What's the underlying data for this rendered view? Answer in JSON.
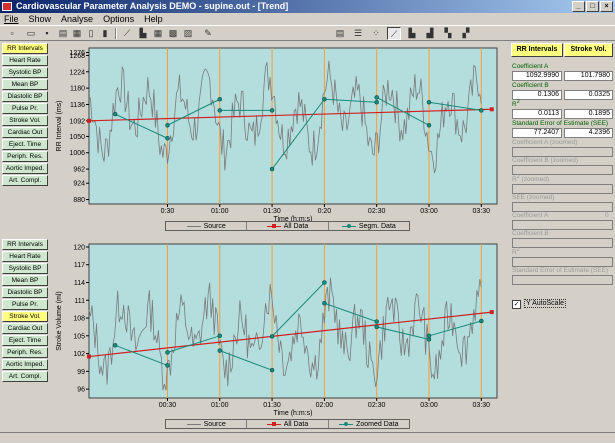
{
  "window": {
    "title": "Cardiovascular Parameter Analysis DEMO - supine.out - [Trend]",
    "min": "_",
    "max": "□",
    "close": "×"
  },
  "menu": [
    "File",
    "Show",
    "Analyse",
    "Options",
    "Help"
  ],
  "toolbar": {
    "icons": [
      "new-icon",
      "open-icon",
      "save-icon",
      "print-icon",
      "print-preview-icon",
      "copy-icon",
      "paste-icon",
      "export-icon",
      "report-icon",
      "line-tool-icon",
      "bar-tool-icon",
      "grid-tool-icon",
      "table-tool-icon",
      "marker-icon",
      "table-view-icon",
      "list-view-icon",
      "scatter-view-icon",
      "trend-view-icon",
      "histogram-view-icon",
      "spectrum-view-icon",
      "stats-view-icon",
      "colour-view-icon"
    ]
  },
  "params_top": [
    "RR Intervals",
    "Heart Rate",
    "Systolic BP",
    "Mean BP",
    "Diastolic BP",
    "Pulse Pr.",
    "Stroke Vol.",
    "Cardiac Out",
    "Eject. Time",
    "Periph. Res.",
    "Aortic Imped.",
    "Art. Compl."
  ],
  "params_top_selected": 0,
  "params_bottom": [
    "RR Intervals",
    "Heart Rate",
    "Systolic BP",
    "Mean BP",
    "Diastolic BP",
    "Pulse Pr.",
    "Stroke Vol.",
    "Cardiac Out",
    "Eject. Time",
    "Periph. Res.",
    "Aortic Imped.",
    "Art. Compl."
  ],
  "params_bottom_selected": 6,
  "chart_data": [
    {
      "type": "line",
      "ylabel": "RR Interval (ms)",
      "xlabel": "Time (h:m:s)",
      "ylim": [
        868,
        1288
      ],
      "y_ticks": [
        880,
        924,
        962,
        1006,
        1050,
        1092,
        1136,
        1180,
        1224,
        1268,
        1276
      ],
      "y_tick_labels": [
        "880",
        "924",
        "962",
        "1006",
        "1050",
        "1092",
        "1136",
        "1180",
        "1224",
        "1268",
        "1276"
      ],
      "x_ticks": [
        "0:30",
        "01:00",
        "01:30",
        "0:20",
        "02:30",
        "03:00",
        "03:30"
      ],
      "series": [
        {
          "name": "Source",
          "style": "oscillating gray trace"
        },
        {
          "name": "All Data",
          "start": 1092,
          "end": 1123
        },
        {
          "name": "Segm. Data",
          "points": [
            [
              0,
              1110
            ],
            [
              0.5,
              1045
            ],
            [
              0.5,
              1080
            ],
            [
              1,
              1150
            ],
            [
              1,
              1120
            ],
            [
              1.5,
              1120
            ],
            [
              1.5,
              962
            ],
            [
              2,
              1150
            ],
            [
              2.5,
              1142
            ],
            [
              2.5,
              1155
            ],
            [
              3,
              1080
            ],
            [
              3,
              1142
            ],
            [
              3.5,
              1120
            ]
          ]
        }
      ],
      "legend": [
        "Source",
        "All Data",
        "Segm. Data"
      ]
    },
    {
      "type": "line",
      "ylabel": "Stroke Volume (ml)",
      "xlabel": "Time (h:m:s)",
      "ylim": [
        94.5,
        120.5
      ],
      "y_ticks": [
        96,
        99,
        102,
        105,
        108,
        111,
        114,
        117,
        120
      ],
      "y_tick_labels": [
        "96",
        "99",
        "102",
        "105",
        "108",
        "111",
        "114",
        "117",
        "120"
      ],
      "x_ticks": [
        "00:30",
        "01:00",
        "01:30",
        "02:00",
        "02:30",
        "03:00",
        "03:30"
      ],
      "series": [
        {
          "name": "Source",
          "style": "oscillating gray trace"
        },
        {
          "name": "All Data",
          "start": 101.5,
          "end": 109.0
        },
        {
          "name": "Zoomed Data",
          "points": [
            [
              0,
              103.4
            ],
            [
              0.5,
              100.0
            ],
            [
              0.5,
              102.2
            ],
            [
              1,
              105.0
            ],
            [
              1,
              102.5
            ],
            [
              1.5,
              99.2
            ],
            [
              1.5,
              104.9
            ],
            [
              2,
              114.0
            ],
            [
              2,
              110.5
            ],
            [
              2.5,
              107.4
            ],
            [
              2.5,
              106.5
            ],
            [
              3,
              104.4
            ],
            [
              3,
              105.0
            ],
            [
              3.5,
              107.5
            ]
          ]
        }
      ],
      "legend": [
        "Source",
        "All Data",
        "Zoomed Data"
      ]
    }
  ],
  "coef": {
    "hdr_left": "RR Intervals",
    "hdr_right": "Stroke Vol.",
    "a_label": "Coefficient A",
    "a_left": "1092.9990",
    "a_right": "101.7980",
    "b_label": "Coefficient B",
    "b_left": "0.1306",
    "b_right": "0.0325",
    "r_label": "R",
    "r_left": "0.0113",
    "r_right": "0.1895",
    "see_label": "Standard Error of Estimate (SEE)",
    "see_left": "77.2407",
    "see_right": "4.2396",
    "az_label": "Coefficient A (zoomed)",
    "bz_label": "Coefficient B (zoomed)",
    "rz_label": "R",
    "rz_suffix": "(zoomed)",
    "seez_label": "SEE (zoomed)",
    "a2_label": "Coefficient A",
    "a2_value": "0",
    "b2_label": "Coefficient B",
    "r2_label": "R",
    "see2_label": "Standard Error of Estimate (SEE)",
    "sup": "2",
    "autoscale_label": "Y AutoScale",
    "autoscale_mark": "✓"
  },
  "colors": {
    "plot_bg": "#b4dede",
    "source": "#7a7a7a",
    "regression": "#d02020",
    "segment": "#1a8a7a",
    "gridline": "#ff9a33"
  }
}
